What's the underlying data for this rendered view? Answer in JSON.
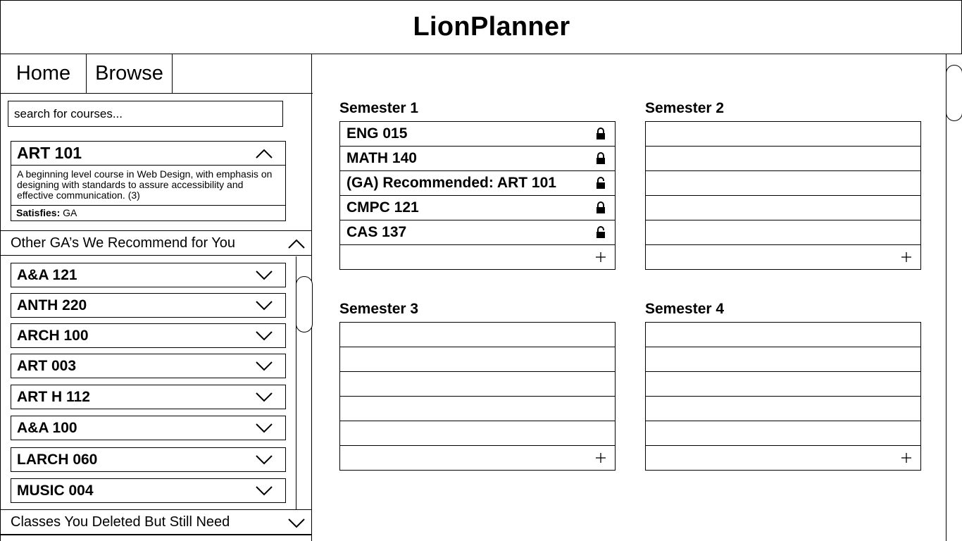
{
  "app": {
    "title": "LionPlanner"
  },
  "tabs": {
    "home": "Home",
    "browse": "Browse"
  },
  "search": {
    "placeholder": "search for courses..."
  },
  "selected_course": {
    "code": "ART 101",
    "description": "A beginning level course in Web Design, with emphasis on designing with standards to assure accessibility and effective communication. (3)",
    "satisfies_label": "Satisfies:",
    "satisfies_value": " GA"
  },
  "recommend": {
    "heading": "Other GA’s We Recommend for You",
    "items": [
      "A&A 121",
      "ANTH 220",
      "ARCH 100",
      "ART 003",
      "ART H 112",
      "A&A 100",
      "LARCH 060",
      "MUSIC 004"
    ]
  },
  "deleted": {
    "heading": "Classes You Deleted But Still Need"
  },
  "semesters": [
    {
      "title": "Semester 1",
      "rows": [
        {
          "label": "ENG 015",
          "lock": "locked"
        },
        {
          "label": "MATH 140",
          "lock": "locked"
        },
        {
          "label": "(GA) Recommended: ART 101",
          "lock": "unlocked"
        },
        {
          "label": "CMPC 121",
          "lock": "locked"
        },
        {
          "label": "CAS 137",
          "lock": "unlocked"
        }
      ]
    },
    {
      "title": "Semester 2",
      "rows": []
    },
    {
      "title": "Semester 3",
      "rows": []
    },
    {
      "title": "Semester 4",
      "rows": []
    }
  ],
  "icons": {
    "collapse": "chevron-up-icon",
    "expand": "chevron-down-icon",
    "locked": "lock-icon",
    "unlocked": "unlock-icon",
    "add": "plus-icon"
  }
}
